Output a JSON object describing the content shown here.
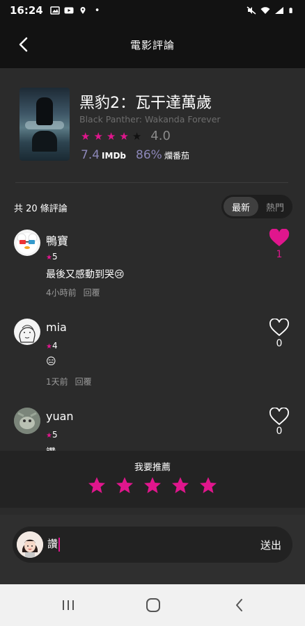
{
  "status_bar": {
    "time": "16:24",
    "dot": "•",
    "left_icons": [
      "gallery-icon",
      "youtube-icon",
      "location-icon"
    ],
    "right_icons": [
      "mute-icon",
      "wifi-icon",
      "signal-icon",
      "battery-icon"
    ]
  },
  "app_bar": {
    "title": "電影評論",
    "back_icon": "back-arrow-icon"
  },
  "movie": {
    "title": "黑豹2：瓦干達萬歲",
    "subtitle": "Black Panther: Wakanda Forever",
    "rating_stars": 4,
    "rating_max": 5,
    "rating_value": "4.0",
    "imdb_score": "7.4",
    "imdb_label": "IMDb",
    "tomato_score": "86%",
    "tomato_label": "爛番茄"
  },
  "reviews_header": {
    "count_text": "共 20 條評論",
    "sort_latest": "最新",
    "sort_hot": "熱門",
    "active_sort": "最新"
  },
  "reviews": [
    {
      "name": "鴨寶",
      "stars": "5",
      "text": "最後又感動到哭😢",
      "time": "4小時前",
      "reply": "回覆",
      "likes": "1",
      "liked": true
    },
    {
      "name": "mia",
      "stars": "4",
      "text": "😑",
      "time": "1天前",
      "reply": "回覆",
      "likes": "0",
      "liked": false
    },
    {
      "name": "yuan",
      "stars": "5",
      "text": "讚",
      "time": "",
      "reply": "",
      "likes": "0",
      "liked": false
    }
  ],
  "recommend": {
    "label": "我要推薦",
    "stars_selected": 5,
    "stars_max": 5
  },
  "comment_input": {
    "value": "讚",
    "send_label": "送出"
  },
  "colors": {
    "accent": "#e0168d",
    "background": "#2b2b2b",
    "header": "#121212",
    "score_purple": "#8c87b8"
  },
  "nav": [
    "recents-icon",
    "home-icon",
    "back-icon"
  ]
}
